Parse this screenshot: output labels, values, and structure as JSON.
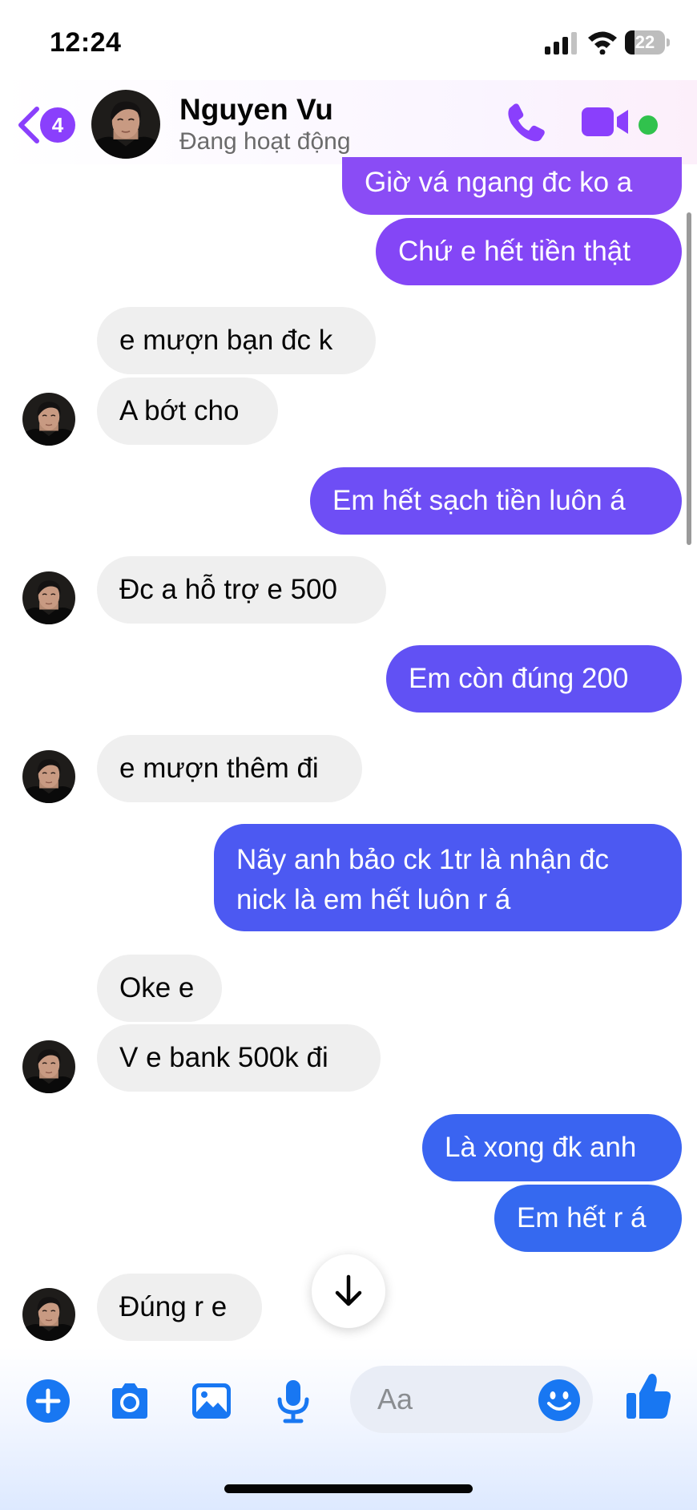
{
  "status_bar": {
    "time": "12:24",
    "battery": "22"
  },
  "header": {
    "back_badge": "4",
    "contact_name": "Nguyen Vu",
    "contact_status": "Đang hoạt động"
  },
  "messages": [
    {
      "side": "out",
      "text": "Giờ vá ngang đc ko a"
    },
    {
      "side": "out",
      "text": "Chứ e hết tiền thật"
    },
    {
      "side": "in",
      "text": "e mượn bạn đc k"
    },
    {
      "side": "in",
      "text": "A bớt cho"
    },
    {
      "side": "out",
      "text": "Em hết sạch tiền luôn á"
    },
    {
      "side": "in",
      "text": "Đc a hỗ trợ e 500"
    },
    {
      "side": "out",
      "text": "Em còn đúng 200"
    },
    {
      "side": "in",
      "text": "e mượn thêm đi"
    },
    {
      "side": "out",
      "text_lines": [
        "Nãy anh bảo ck 1tr là nhận đc",
        "nick là em hết luôn r á"
      ]
    },
    {
      "side": "in",
      "text": "Oke e"
    },
    {
      "side": "in",
      "text": "V e bank 500k đi"
    },
    {
      "side": "out",
      "text": "Là xong đk anh"
    },
    {
      "side": "out",
      "text": "Em hết r á"
    },
    {
      "side": "in",
      "text": "Đúng r e"
    }
  ],
  "composer": {
    "placeholder": "Aa"
  },
  "icons": {
    "back": "chevron-left-icon",
    "call": "phone-icon",
    "video": "video-camera-icon",
    "scroll_down": "arrow-down-icon",
    "add": "plus-circle-icon",
    "camera": "camera-icon",
    "gallery": "image-icon",
    "mic": "microphone-icon",
    "emoji": "smiley-icon",
    "like": "thumbs-up-icon"
  },
  "colors": {
    "accent_purple": "#8a3ffc",
    "accent_blue": "#1877f2",
    "online_green": "#31c24d",
    "incoming_bubble": "#efefef"
  }
}
